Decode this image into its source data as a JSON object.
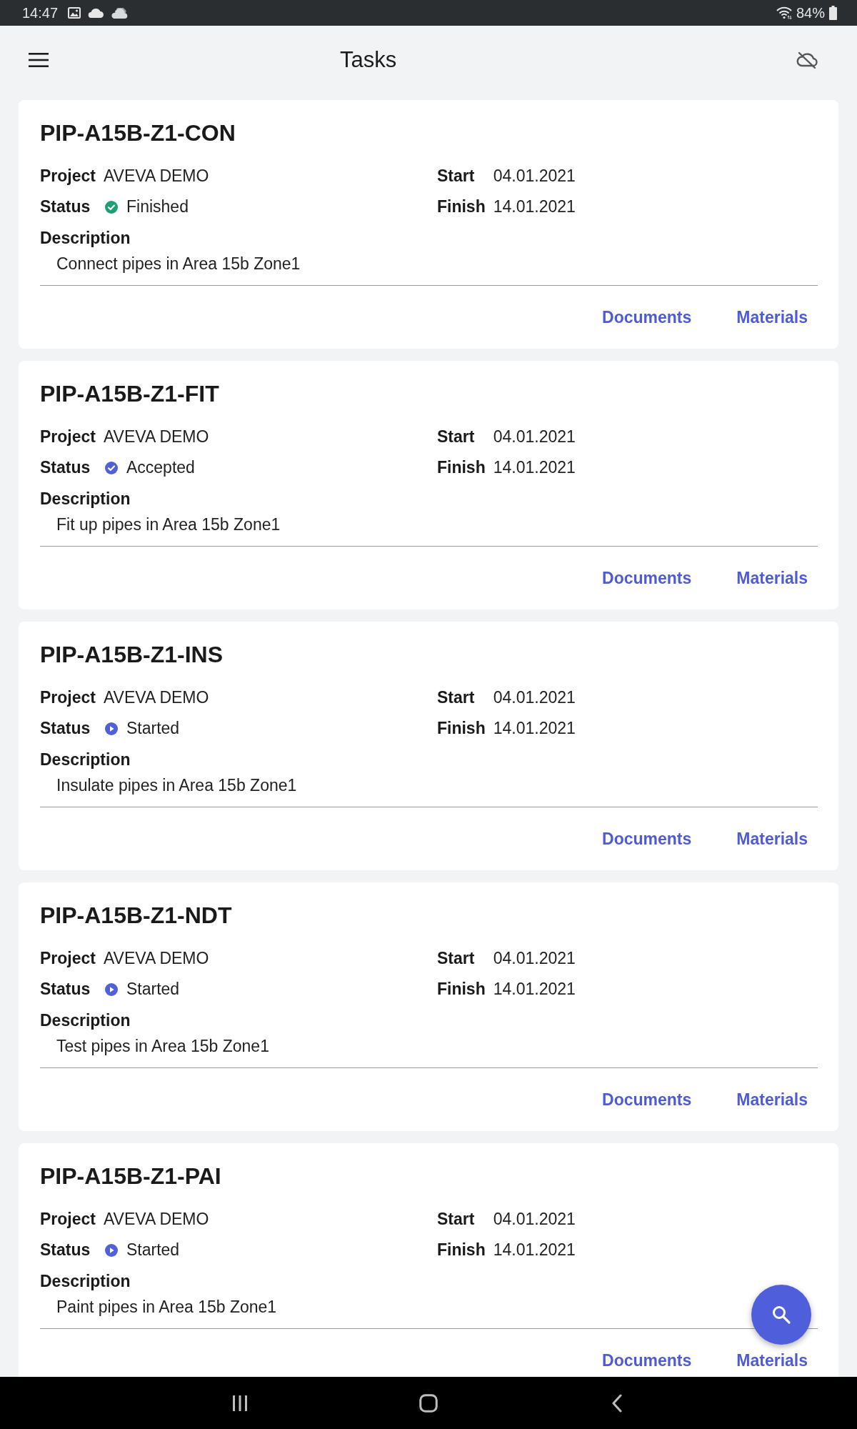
{
  "status_bar": {
    "time": "14:47",
    "battery": "84%"
  },
  "app_bar": {
    "title": "Tasks"
  },
  "tasks": [
    {
      "code": "PIP-A15B-Z1-CON",
      "project_label": "Project",
      "project": "AVEVA DEMO",
      "start_label": "Start",
      "start": "04.01.2021",
      "status_label": "Status",
      "status": {
        "text": "Finished",
        "kind": "done",
        "color": "#1f9e6f"
      },
      "finish_label": "Finish",
      "finish": "14.01.2021",
      "description_label": "Description",
      "description": "Connect pipes in Area 15b Zone1",
      "actions": [
        {
          "label": "Documents"
        },
        {
          "label": "Materials"
        }
      ]
    },
    {
      "code": "PIP-A15B-Z1-FIT",
      "project_label": "Project",
      "project": "AVEVA DEMO",
      "start_label": "Start",
      "start": "04.01.2021",
      "status_label": "Status",
      "status": {
        "text": "Accepted",
        "kind": "done",
        "color": "#5060d8"
      },
      "finish_label": "Finish",
      "finish": "14.01.2021",
      "description_label": "Description",
      "description": "Fit up pipes in Area 15b Zone1",
      "actions": [
        {
          "label": "Documents"
        },
        {
          "label": "Materials"
        }
      ]
    },
    {
      "code": "PIP-A15B-Z1-INS",
      "project_label": "Project",
      "project": "AVEVA DEMO",
      "start_label": "Start",
      "start": "04.01.2021",
      "status_label": "Status",
      "status": {
        "text": "Started",
        "kind": "ongoing",
        "color": "#5060d8"
      },
      "finish_label": "Finish",
      "finish": "14.01.2021",
      "description_label": "Description",
      "description": "Insulate pipes in Area 15b Zone1",
      "actions": [
        {
          "label": "Documents"
        },
        {
          "label": "Materials"
        }
      ]
    },
    {
      "code": "PIP-A15B-Z1-NDT",
      "project_label": "Project",
      "project": "AVEVA DEMO",
      "start_label": "Start",
      "start": "04.01.2021",
      "status_label": "Status",
      "status": {
        "text": "Started",
        "kind": "ongoing",
        "color": "#5060d8"
      },
      "finish_label": "Finish",
      "finish": "14.01.2021",
      "description_label": "Description",
      "description": "Test pipes in Area 15b Zone1",
      "actions": [
        {
          "label": "Documents"
        },
        {
          "label": "Materials"
        }
      ]
    },
    {
      "code": "PIP-A15B-Z1-PAI",
      "project_label": "Project",
      "project": "AVEVA DEMO",
      "start_label": "Start",
      "start": "04.01.2021",
      "status_label": "Status",
      "status": {
        "text": "Started",
        "kind": "ongoing",
        "color": "#5060d8"
      },
      "finish_label": "Finish",
      "finish": "14.01.2021",
      "description_label": "Description",
      "description": "Paint pipes in Area 15b Zone1",
      "actions": [
        {
          "label": "Documents"
        },
        {
          "label": "Materials"
        }
      ]
    }
  ]
}
